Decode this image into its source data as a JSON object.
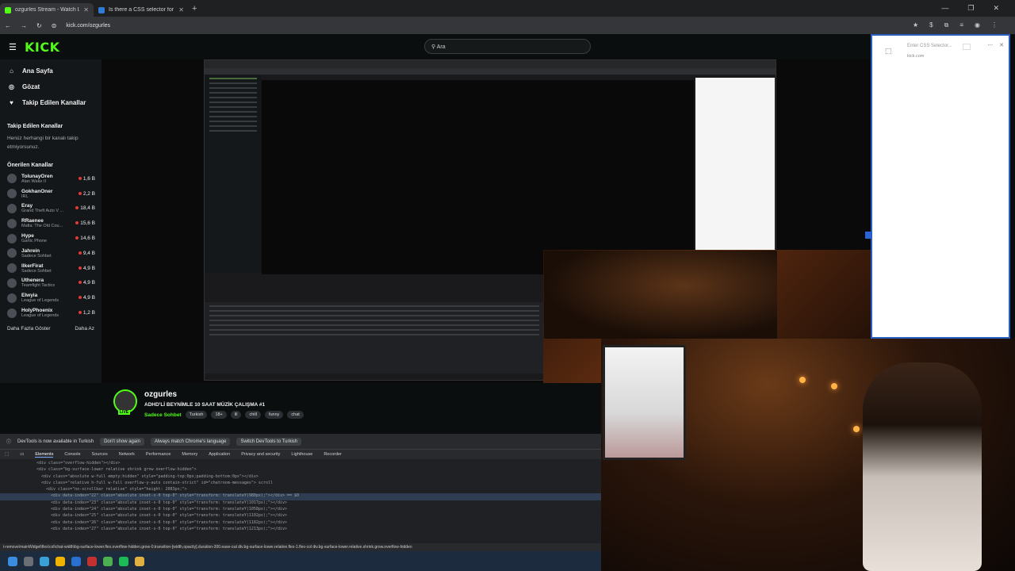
{
  "browser": {
    "tabs": [
      {
        "title": "ozgurles Stream - Watch Live o",
        "active": true
      },
      {
        "title": "Is there a CSS selector for elem",
        "active": false
      }
    ],
    "url": "kick.com/ozgurles",
    "window_controls": {
      "minimize": "—",
      "maximize": "❐",
      "close": "✕"
    }
  },
  "kick": {
    "logo": "KICK",
    "search_placeholder": "Ara",
    "nav": [
      {
        "label": "Ana Sayfa",
        "icon": "home-icon"
      },
      {
        "label": "Gözat",
        "icon": "browse-icon"
      },
      {
        "label": "Takip Edilen Kanallar",
        "icon": "heart-icon"
      }
    ],
    "followed_title": "Takip Edilen Kanallar",
    "followed_empty": "Henüz herhangi bir kanalı takip etmiyorsunuz.",
    "recommended_title": "Önerilen Kanallar",
    "channels": [
      {
        "name": "TolunayOren",
        "category": "Alan Wake II",
        "viewers": "1,6 B"
      },
      {
        "name": "GokhanOner",
        "category": "IRL",
        "viewers": "2,2 B"
      },
      {
        "name": "Eray",
        "category": "Grand Theft Auto V ...",
        "viewers": "18,4 B"
      },
      {
        "name": "RRaenee",
        "category": "Mafia: The Old Cou...",
        "viewers": "15,6 B"
      },
      {
        "name": "Hype",
        "category": "Gartic Phone",
        "viewers": "14,6 B"
      },
      {
        "name": "Jahrein",
        "category": "Sadece Sohbet",
        "viewers": "9,4 B"
      },
      {
        "name": "llkerFirat",
        "category": "Sadece Sohbet",
        "viewers": "4,9 B"
      },
      {
        "name": "Uthenera",
        "category": "Teamfight Tactics",
        "viewers": "4,9 B"
      },
      {
        "name": "Elwyia",
        "category": "League of Legends",
        "viewers": "4,9 B"
      },
      {
        "name": "HolyPhoenix",
        "category": "League of Legends",
        "viewers": "1,2 B"
      }
    ],
    "show_more": "Daha Fazla Göster",
    "show_less": "Daha Az"
  },
  "stream": {
    "username": "ozgurles",
    "title": "ADHD'Lİ BEYNİMLE 10 SAAT MÜZİK ÇALIŞMA #1",
    "category": "Sadece Sohbet",
    "tags": [
      "Turkish",
      "18+",
      "lil",
      "chill",
      "funny",
      "chat"
    ],
    "live_badge": "LIVE"
  },
  "devtools": {
    "banner_text": "DevTools is now available in Turkish",
    "banner_buttons": [
      "Don't show again",
      "Always match Chrome's language",
      "Switch DevTools to Turkish"
    ],
    "tabs": [
      "Elements",
      "Console",
      "Sources",
      "Network",
      "Performance",
      "Memory",
      "Application",
      "Privacy and security",
      "Lighthouse",
      "Recorder"
    ],
    "active_tab": "Elements",
    "code_lines": [
      "<div class=\"overflow-hidden\"></div>",
      "<div class=\"bg-surface-lower relative shrink grow overflow-hidden\">",
      "  <div class=\"absolute w-full empty:hidden\" style=\"padding-top:0px;padding-bottom:0px\"></div>",
      "  <div class=\"relative h-full w-full overflow-y-auto contain-strict\" id=\"chatroom-messages\"> scroll",
      "    <div class=\"no-scrollbar relative\" style=\"height: 2083px;\">",
      "      <div data-index=\"22\" class=\"absolute inset-x-0 top-0\" style=\"transform: translateY(980px);\"></div> == $0",
      "      <div data-index=\"23\" class=\"absolute inset-x-0 top-0\" style=\"transform: translateY(1017px);\"></div>",
      "      <div data-index=\"24\" class=\"absolute inset-x-0 top-0\" style=\"transform: translateY(1058px);\"></div>",
      "      <div data-index=\"25\" class=\"absolute inset-x-0 top-0\" style=\"transform: translateY(1102px);\"></div>",
      "      <div data-index=\"26\" class=\"absolute inset-x-0 top-0\" style=\"transform: translateY(1182px);\"></div>",
      "      <div data-index=\"27\" class=\"absolute inset-x-0 top-0\" style=\"transform: translateY(1213px);\"></div>"
    ],
    "breadcrumb": "t-remove\\mainWidget\\flex\\col\\chat-width\\bg-surface-lower.flex.overflow-hidden.grow-0.transition-[width,opacity].duration-300.ease-out    div.bg-surface-lower.relative.flex-1.flex-col    div.bg-surface-lower.relative.shrink.grow.overflow-hidden"
  },
  "side_panel": {
    "input_placeholder": "Enter CSS Selector...",
    "subtext": "kick.com"
  }
}
